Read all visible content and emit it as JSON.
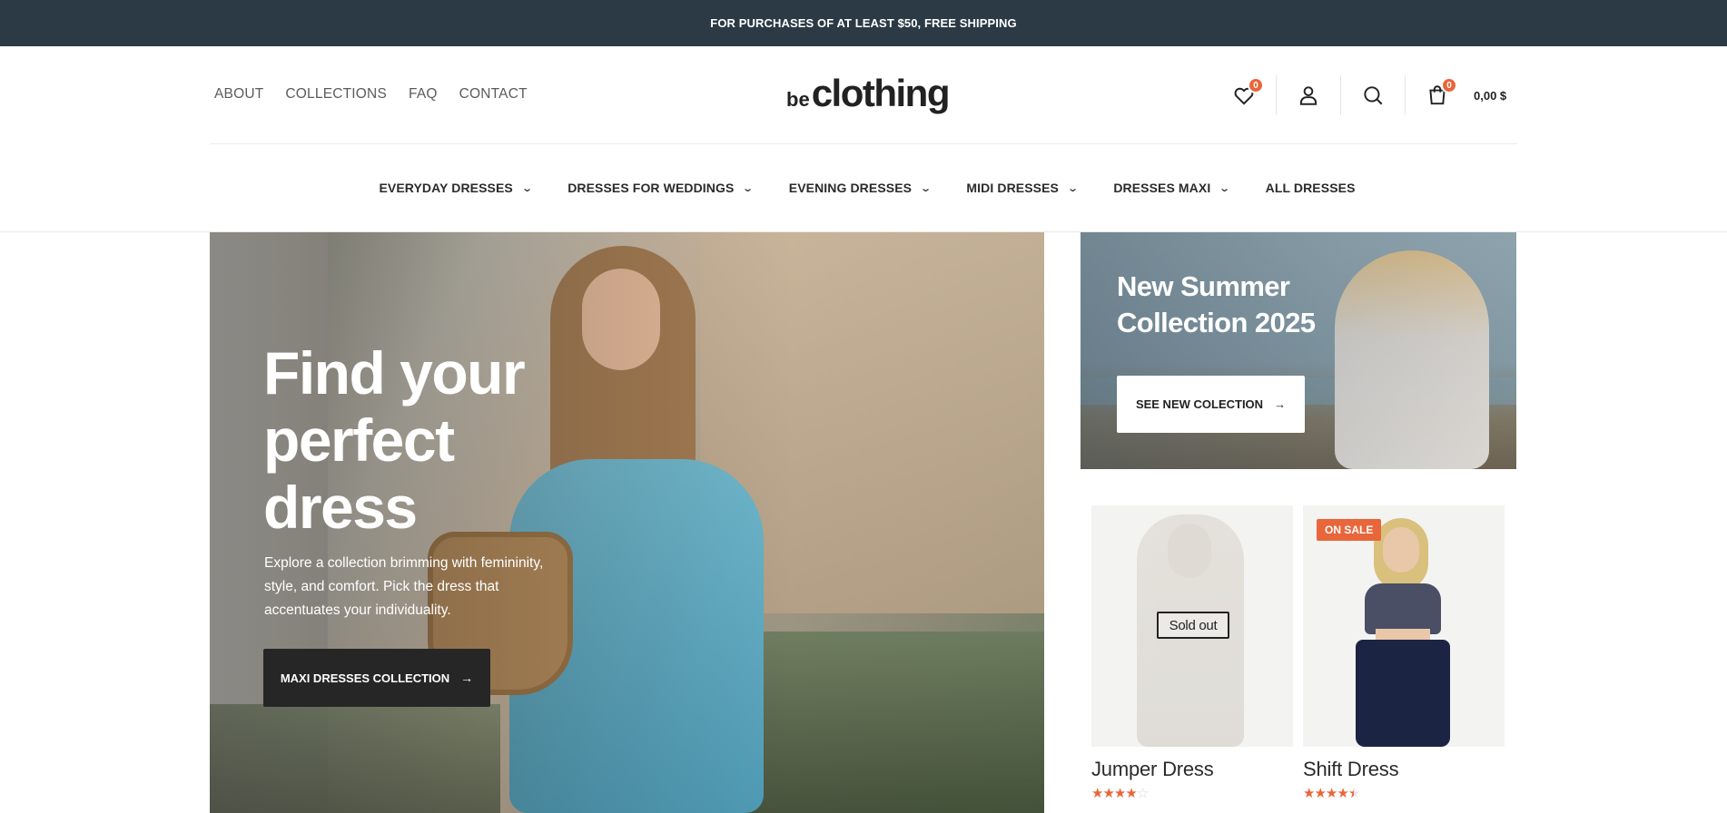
{
  "topbar": {
    "text": "FOR PURCHASES OF AT LEAST $50, FREE SHIPPING"
  },
  "header": {
    "nav": [
      "ABOUT",
      "COLLECTIONS",
      "FAQ",
      "CONTACT"
    ],
    "logo": {
      "prefix": "be",
      "main": "clothing"
    },
    "wishlist_count": "0",
    "cart_count": "0",
    "cart_total": "0,00 $"
  },
  "categories": [
    {
      "label": "EVERYDAY DRESSES",
      "has_dropdown": true
    },
    {
      "label": "DRESSES FOR WEDDINGS",
      "has_dropdown": true
    },
    {
      "label": "EVENING DRESSES",
      "has_dropdown": true
    },
    {
      "label": "MIDI DRESSES",
      "has_dropdown": true
    },
    {
      "label": "DRESSES MAXI",
      "has_dropdown": true
    },
    {
      "label": "ALL DRESSES",
      "has_dropdown": false
    }
  ],
  "hero": {
    "title_lines": [
      "Find your",
      "perfect",
      "dress"
    ],
    "text": "Explore a collection brimming with femininity, style, and comfort. Pick the dress that accentuates your individuality.",
    "button": "MAXI DRESSES COLLECTION"
  },
  "promo": {
    "title_lines": [
      "New Summer",
      "Collection 2025"
    ],
    "button": "SEE NEW COLECTION"
  },
  "products": [
    {
      "name": "Jumper Dress",
      "rating": 4,
      "max_rating": 5,
      "badge": "Sold out"
    },
    {
      "name": "Shift Dress",
      "rating": 4.5,
      "max_rating": 5,
      "badge": "ON SALE"
    }
  ],
  "colors": {
    "topbar_bg": "#2b3a44",
    "accent": "#e8663a",
    "dark_button": "#262626"
  },
  "icons": [
    "heart-icon",
    "user-icon",
    "search-icon",
    "cart-icon",
    "chevron-down-icon",
    "arrow-right-icon",
    "star-icon"
  ]
}
